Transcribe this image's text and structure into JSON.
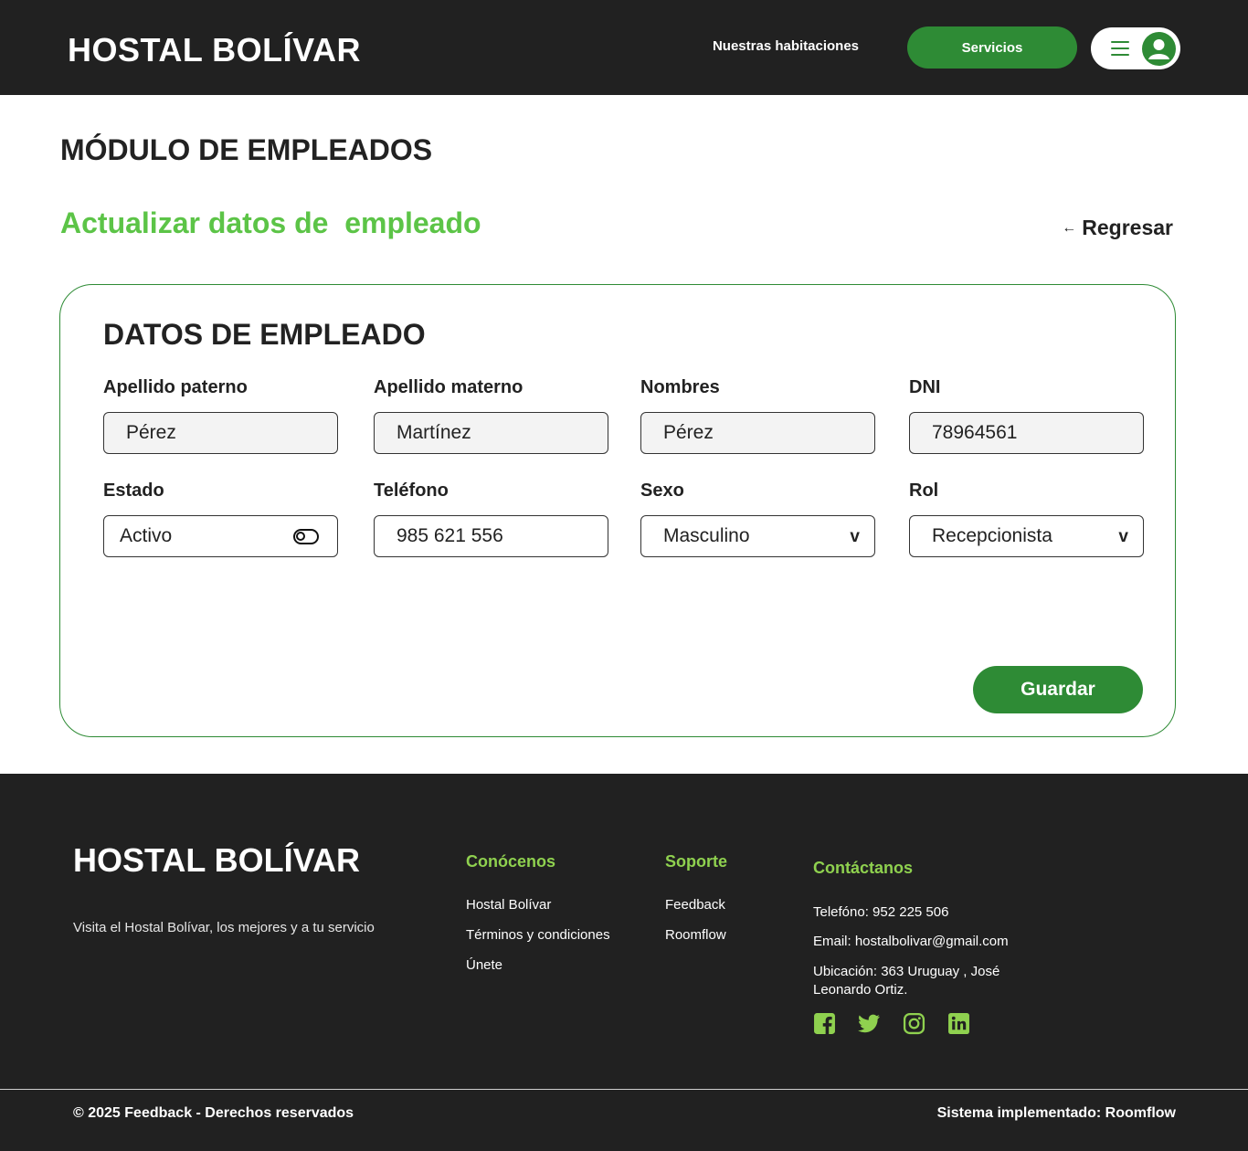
{
  "header": {
    "brand": "HOSTAL BOLÍVAR",
    "nav_link": "Nuestras habitaciones",
    "nav_button": "Servicios",
    "menu_icon": "hamburger-menu-icon",
    "avatar_icon": "user-avatar-icon"
  },
  "page": {
    "title": "MÓDULO DE EMPLEADOS",
    "subtitle": "Actualizar datos de  empleado",
    "back_label": "Regresar",
    "back_arrow": "←"
  },
  "form": {
    "title": "DATOS DE EMPLEADO",
    "fields": {
      "apellido_paterno": {
        "label": "Apellido paterno",
        "value": "Pérez"
      },
      "apellido_materno": {
        "label": "Apellido materno",
        "value": "Martínez"
      },
      "nombres": {
        "label": "Nombres",
        "value": "Pérez"
      },
      "dni": {
        "label": "DNI",
        "value": "78964561"
      },
      "estado": {
        "label": "Estado",
        "value": "Activo"
      },
      "telefono": {
        "label": "Teléfono",
        "value": "985 621 556"
      },
      "sexo": {
        "label": "Sexo",
        "value": "Masculino"
      },
      "rol": {
        "label": "Rol",
        "value": "Recepcionista"
      }
    },
    "chevron": "v",
    "save_label": "Guardar"
  },
  "footer": {
    "brand": "HOSTAL BOLÍVAR",
    "description": "Visita el Hostal Bolívar, los mejores y a tu servicio",
    "conocenos": {
      "heading": "Conócenos",
      "links": [
        "Hostal Bolívar",
        "Términos y condiciones",
        "Únete"
      ]
    },
    "soporte": {
      "heading": "Soporte",
      "links": [
        "Feedback",
        "Roomflow"
      ]
    },
    "contacto": {
      "heading": "Contáctanos",
      "telefono": "Telefóno: 952 225 506",
      "email": "Email: hostalbolivar@gmail.com",
      "ubicacion": "Ubicación: 363 Uruguay , José Leonardo Ortiz."
    },
    "socials": [
      "facebook-icon",
      "twitter-icon",
      "instagram-icon",
      "linkedin-icon"
    ],
    "copyright": "© 2025 Feedback - Derechos reservados",
    "implemented": "Sistema implementado: Roomflow"
  },
  "colors": {
    "dark": "#212121",
    "primary_green": "#2e8b35",
    "light_green": "#5cc447",
    "footer_accent": "#8fd14f"
  }
}
